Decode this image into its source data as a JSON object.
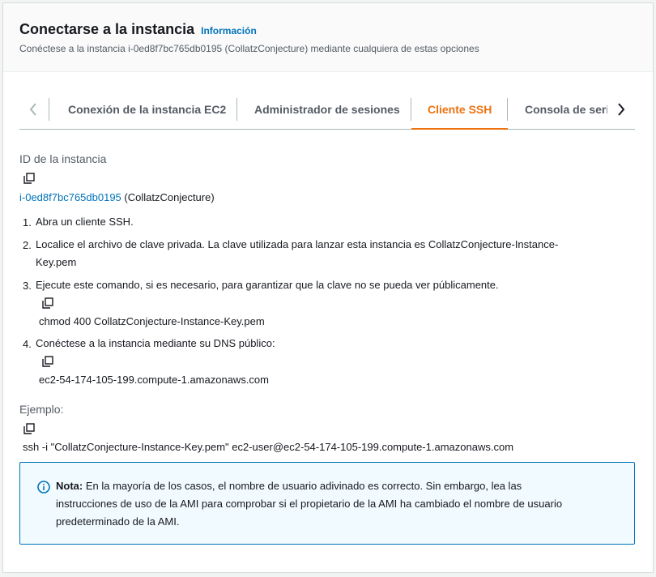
{
  "header": {
    "title": "Conectarse a la instancia",
    "info_link": "Información",
    "subtitle": "Conéctese a la instancia i-0ed8f7bc765db0195 (CollatzConjecture) mediante cualquiera de estas opciones"
  },
  "tabs": [
    {
      "label": "Conexión de la instancia EC2",
      "active": false
    },
    {
      "label": "Administrador de sesiones",
      "active": false
    },
    {
      "label": "Cliente SSH",
      "active": true
    },
    {
      "label": "Consola de serie",
      "active": false
    }
  ],
  "instance": {
    "label": "ID de la instancia",
    "id": "i-0ed8f7bc765db0195",
    "name": "(CollatzConjecture)"
  },
  "steps": [
    {
      "num": "1.",
      "text": "Abra un cliente SSH."
    },
    {
      "num": "2.",
      "text_line1": "Localice el archivo de clave privada. La clave utilizada para lanzar esta instancia es CollatzConjecture-Instance-",
      "text_line2": "Key.pem"
    },
    {
      "num": "3.",
      "text": "Ejecute este comando, si es necesario, para garantizar que la clave no se pueda ver públicamente.",
      "command": "chmod 400 CollatzConjecture-Instance-Key.pem"
    },
    {
      "num": "4.",
      "text": "Conéctese a la instancia mediante su DNS público:",
      "command": "ec2-54-174-105-199.compute-1.amazonaws.com"
    }
  ],
  "example": {
    "label": "Ejemplo:",
    "command": "ssh -i \"CollatzConjecture-Instance-Key.pem\" ec2-user@ec2-54-174-105-199.compute-1.amazonaws.com"
  },
  "note": {
    "bold": "Nota:",
    "line1": " En la mayoría de los casos, el nombre de usuario adivinado es correcto. Sin embargo, lea las",
    "line2": "instrucciones de uso de la AMI para comprobar si el propietario de la AMI ha cambiado el nombre de usuario",
    "line3": "predeterminado de la AMI."
  },
  "colors": {
    "accent_active_tab": "#ec7211",
    "link": "#0073bb",
    "note_bg": "#f1faff"
  }
}
